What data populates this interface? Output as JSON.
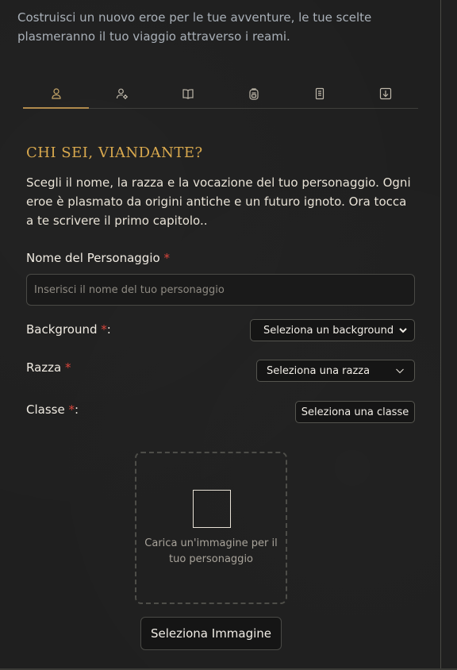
{
  "intro": {
    "text": "Costruisci un nuovo eroe per le tue avventure, le tue scelte plasmeranno il tuo viaggio attraverso i reami."
  },
  "tabs": [
    {
      "icon": "user-icon",
      "active": true
    },
    {
      "icon": "user-settings-icon",
      "active": false
    },
    {
      "icon": "book-icon",
      "active": false
    },
    {
      "icon": "backpack-icon",
      "active": false
    },
    {
      "icon": "scroll-icon",
      "active": false
    },
    {
      "icon": "download-icon",
      "active": false
    }
  ],
  "section": {
    "title": "CHI SEI, VIANDANTE?",
    "description": "Scegli il nome, la razza e la vocazione del tuo personaggio. Ogni eroe è plasmato da origini antiche e un futuro ignoto. Ora tocca a te scrivere il primo capitolo.."
  },
  "form": {
    "name_label": "Nome del Personaggio",
    "name_placeholder": "Inserisci il nome del tuo personaggio",
    "required_mark": "*",
    "background_label": "Background",
    "background_value": "Seleziona un background",
    "race_label": "Razza",
    "race_value": "Seleziona una razza",
    "class_label": "Classe",
    "class_button": "Seleziona una classe",
    "colon": ":"
  },
  "upload": {
    "hint": "Carica un'immagine per il tuo personaggio",
    "button": "Seleziona Immagine"
  },
  "colors": {
    "accent": "#d9a94e",
    "required": "#d9463c",
    "background": "#1f1f1f"
  }
}
